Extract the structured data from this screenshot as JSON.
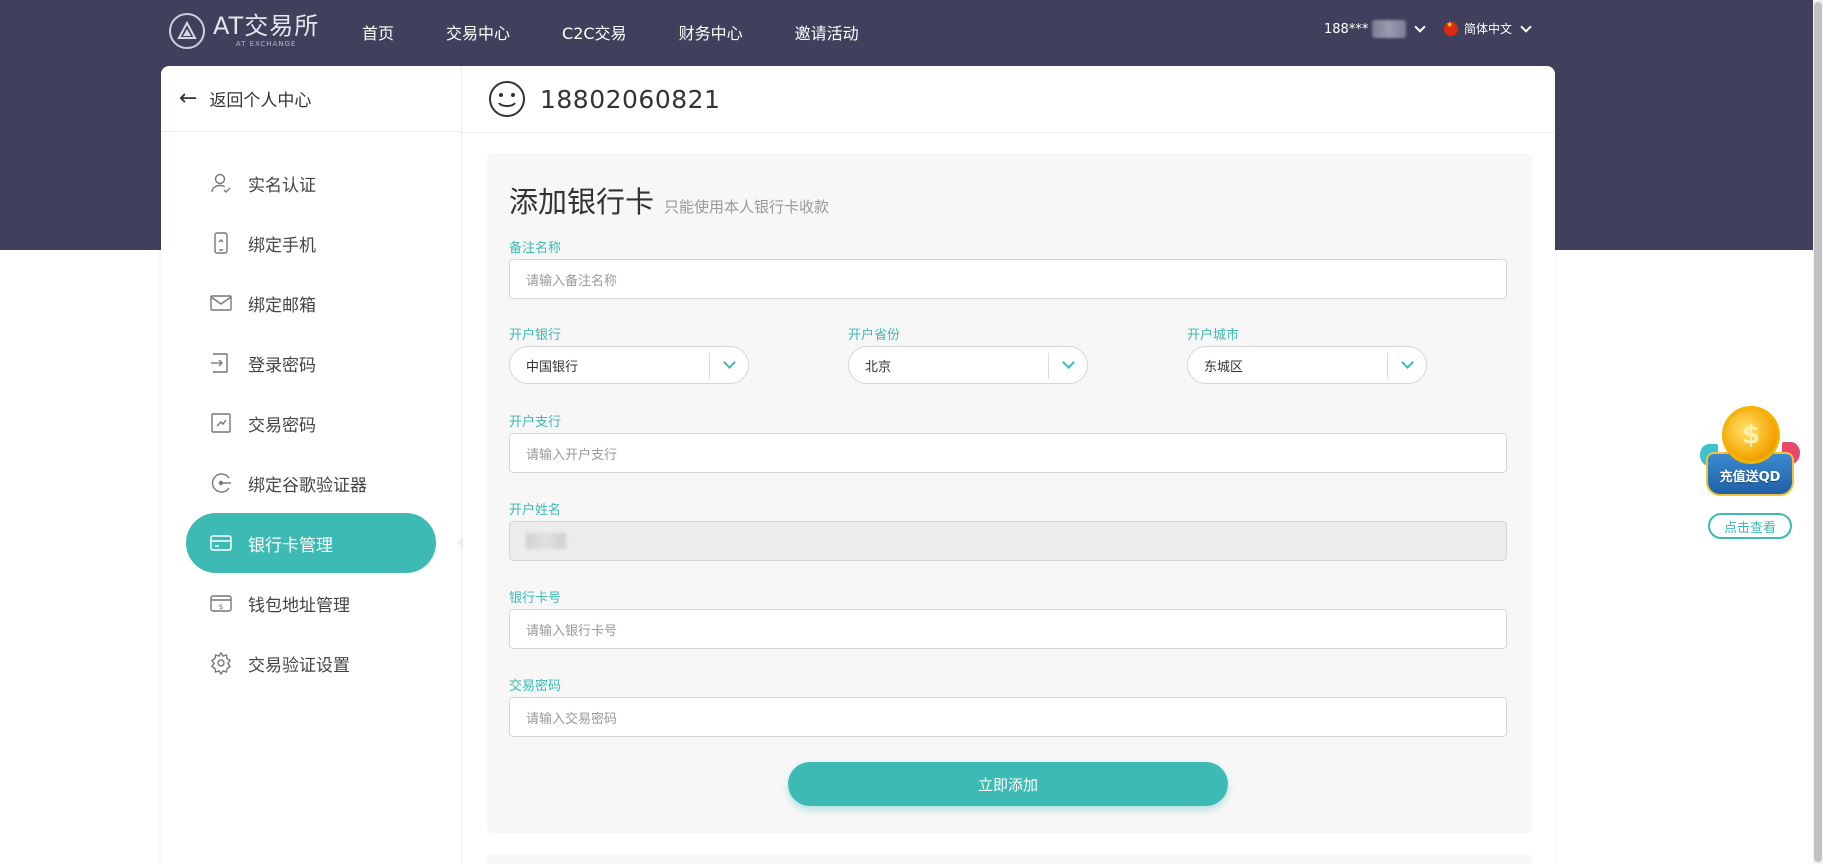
{
  "brand": {
    "name": "AT交易所",
    "tagline": "AT EXCHANGE"
  },
  "nav": {
    "items": [
      {
        "label": "首页"
      },
      {
        "label": "交易中心"
      },
      {
        "label": "C2C交易"
      },
      {
        "label": "财务中心"
      },
      {
        "label": "邀请活动"
      }
    ],
    "user": "188***",
    "language": "简体中文"
  },
  "sidebar": {
    "back_label": "返回个人中心",
    "items": [
      {
        "label": "实名认证",
        "icon": "user-check-icon"
      },
      {
        "label": "绑定手机",
        "icon": "phone-icon"
      },
      {
        "label": "绑定邮箱",
        "icon": "mail-icon"
      },
      {
        "label": "登录密码",
        "icon": "login-icon"
      },
      {
        "label": "交易密码",
        "icon": "trade-password-icon"
      },
      {
        "label": "绑定谷歌验证器",
        "icon": "google-auth-icon"
      },
      {
        "label": "银行卡管理",
        "icon": "bank-card-icon",
        "active": true
      },
      {
        "label": "钱包地址管理",
        "icon": "wallet-icon"
      },
      {
        "label": "交易验证设置",
        "icon": "gear-icon"
      }
    ]
  },
  "header": {
    "account": "18802060821",
    "avatar_icon": "smiley-icon"
  },
  "form": {
    "title": "添加银行卡",
    "subtitle": "只能使用本人银行卡收款",
    "remark": {
      "label": "备注名称",
      "placeholder": "请输入备注名称"
    },
    "bank": {
      "label": "开户银行",
      "value": "中国银行"
    },
    "province": {
      "label": "开户省份",
      "value": "北京"
    },
    "city": {
      "label": "开户城市",
      "value": "东城区"
    },
    "branch": {
      "label": "开户支行",
      "placeholder": "请输入开户支行"
    },
    "holder": {
      "label": "开户姓名"
    },
    "card_no": {
      "label": "银行卡号",
      "placeholder": "请输入银行卡号"
    },
    "trade_pwd": {
      "label": "交易密码",
      "placeholder": "请输入交易密码"
    },
    "submit_label": "立即添加"
  },
  "promo": {
    "badge_text": "充值送QD",
    "coin_symbol": "$",
    "link_label": "点击查看"
  },
  "colors": {
    "accent": "#3dbab4",
    "header_bg": "#40405c"
  }
}
